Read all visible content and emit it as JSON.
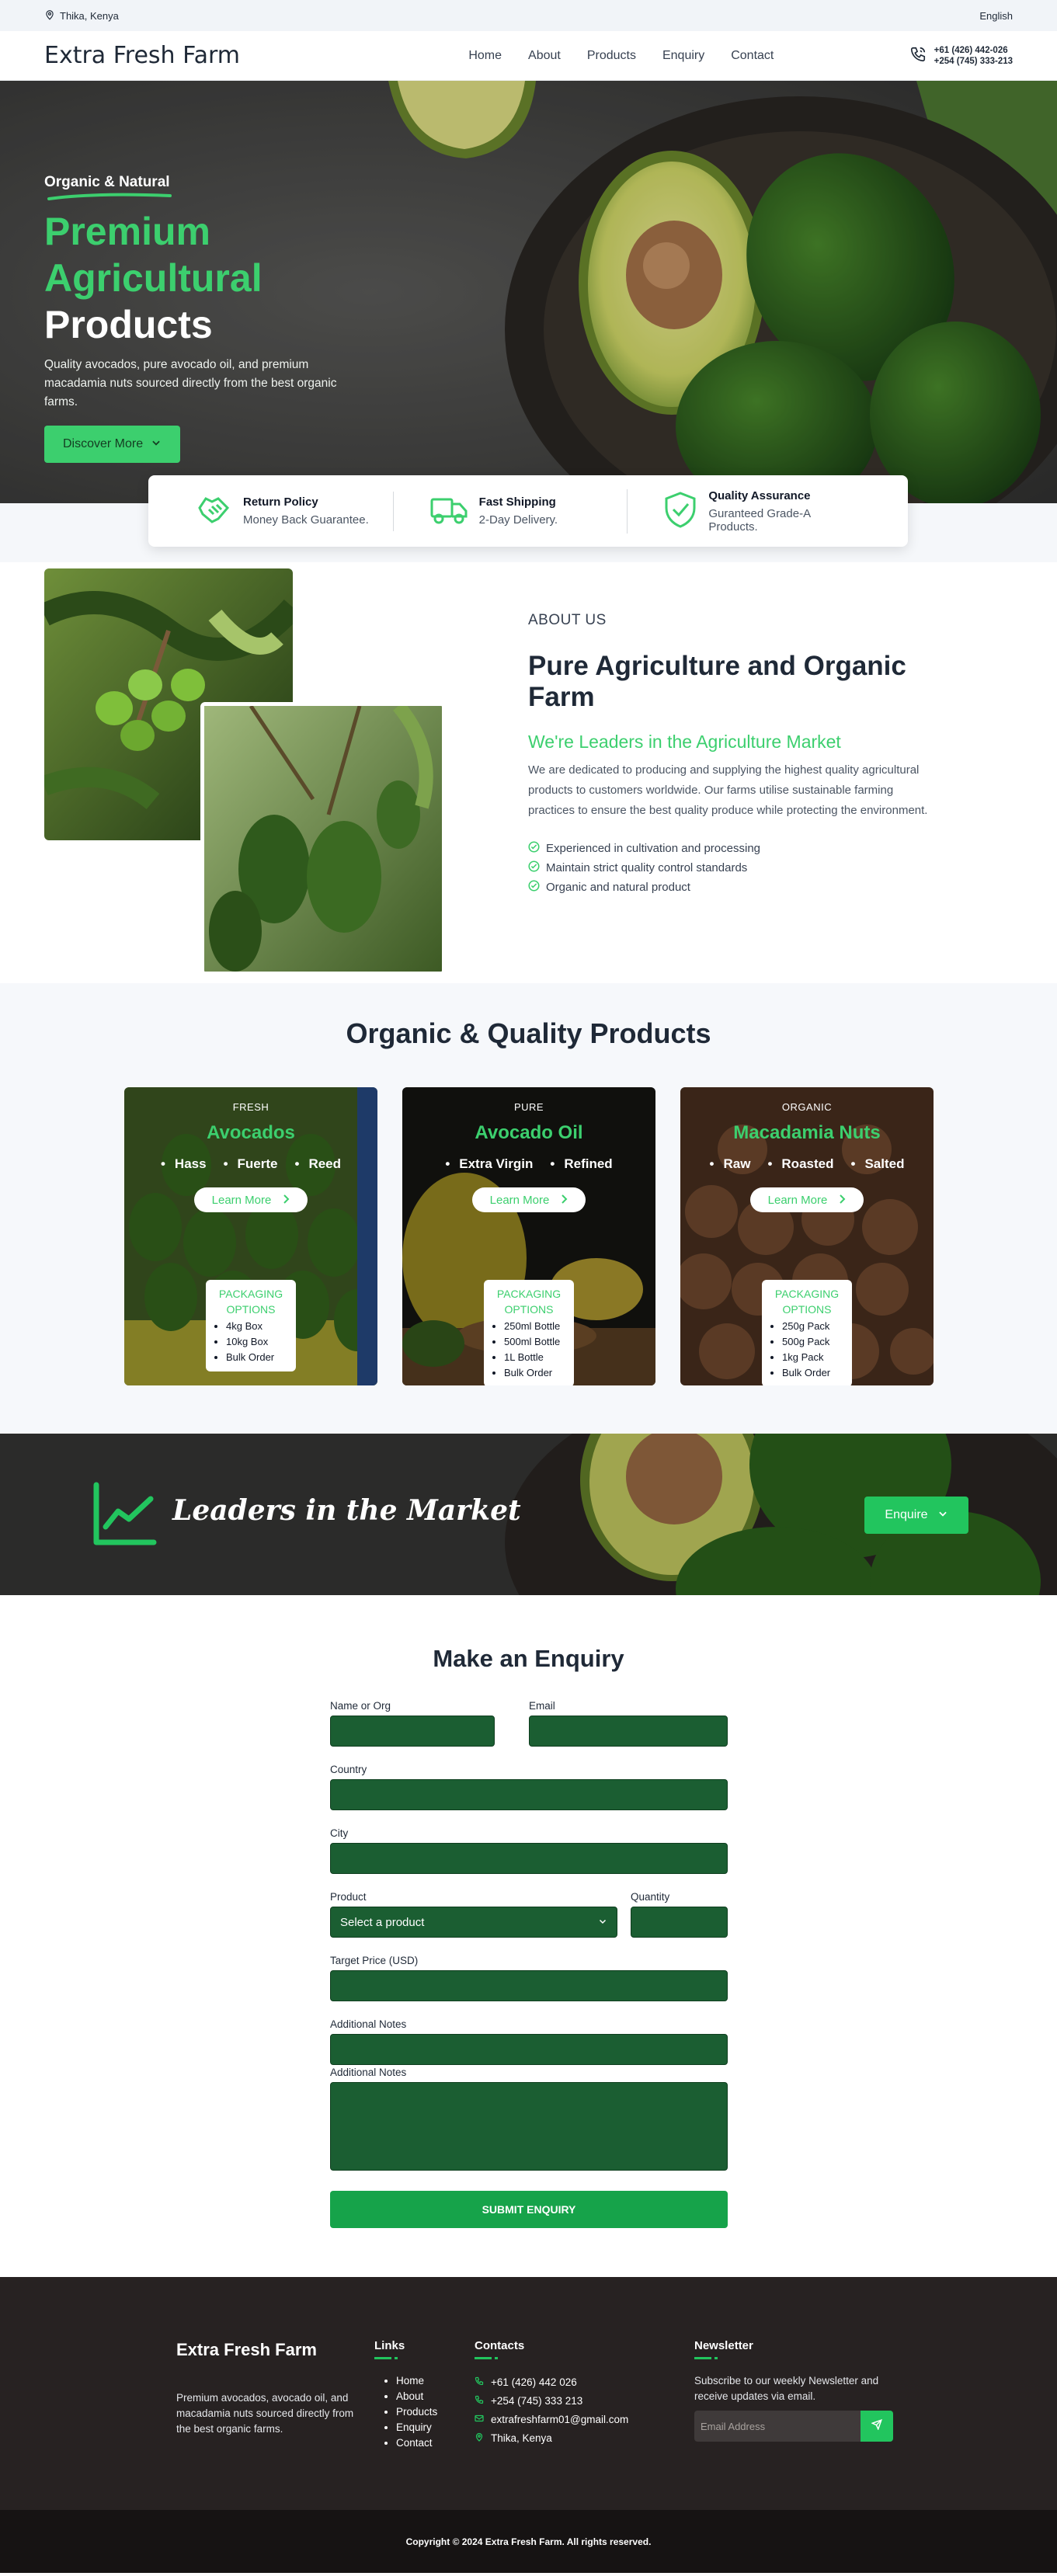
{
  "topbar": {
    "location": "Thika, Kenya",
    "language": "English"
  },
  "nav": {
    "brand": "Extra Fresh Farm",
    "menu": [
      "Home",
      "About",
      "Products",
      "Enquiry",
      "Contact"
    ],
    "phones": [
      "+61 (426) 442-026",
      "+254 (745) 333-213"
    ]
  },
  "hero": {
    "tag": "Organic & Natural",
    "title_green": "Premium Agricultural",
    "title_white": "Products",
    "description": "Quality avocados, pure avocado oil, and premium macadamia nuts sourced directly from the best organic farms.",
    "button": "Discover More"
  },
  "features": [
    {
      "title": "Return Policy",
      "subtitle": "Money Back Guarantee.",
      "icon": "handshake-icon"
    },
    {
      "title": "Fast Shipping",
      "subtitle": "2-Day Delivery.",
      "icon": "truck-icon"
    },
    {
      "title": "Quality Assurance",
      "subtitle": "Guranteed Grade-A Products.",
      "icon": "shield-check-icon"
    }
  ],
  "about": {
    "overline": "ABOUT US",
    "title": "Pure Agriculture and Organic Farm",
    "subtitle": "We're Leaders in the Agriculture Market",
    "description": "We are dedicated to producing and supplying the highest quality agricultural products to customers worldwide. Our farms utilise sustainable farming practices to ensure the best quality produce while protecting the environment.",
    "points": [
      "Experienced in cultivation and processing",
      "Maintain strict quality control standards",
      "Organic and natural product"
    ]
  },
  "products": {
    "title": "Organic & Quality Products",
    "packaging_title": "PACKAGING OPTIONS",
    "learn_more": "Learn More",
    "items": [
      {
        "kind": "FRESH",
        "name": "Avocados",
        "types": [
          "Hass",
          "Fuerte",
          "Reed"
        ],
        "packaging": [
          "4kg Box",
          "10kg Box",
          "Bulk Order"
        ]
      },
      {
        "kind": "PURE",
        "name": "Avocado Oil",
        "types": [
          "Extra Virgin",
          "Refined"
        ],
        "packaging": [
          "250ml Bottle",
          "500ml Bottle",
          "1L Bottle",
          "Bulk Order"
        ]
      },
      {
        "kind": "ORGANIC",
        "name": "Macadamia Nuts",
        "types": [
          "Raw",
          "Roasted",
          "Salted"
        ],
        "packaging": [
          "250g Pack",
          "500g Pack",
          "1kg Pack",
          "Bulk Order"
        ]
      }
    ]
  },
  "leaders": {
    "title": "Leaders in the Market",
    "button": "Enquire"
  },
  "enquiry": {
    "title": "Make an Enquiry",
    "labels": {
      "name": "Name or Org",
      "email": "Email",
      "country": "Country",
      "city": "City",
      "product": "Product",
      "quantity": "Quantity",
      "target_price": "Target Price (USD)",
      "notes1": "Additional Notes",
      "notes2": "Additional Notes"
    },
    "product_select": "Select a product",
    "submit": "SUBMIT ENQUIRY"
  },
  "footer": {
    "brand": "Extra Fresh Farm",
    "description": "Premium avocados, avocado oil, and macadamia nuts sourced directly from the best organic farms.",
    "links_title": "Links",
    "links": [
      "Home",
      "About",
      "Products",
      "Enquiry",
      "Contact"
    ],
    "contacts_title": "Contacts",
    "contacts": [
      "+61 (426) 442 026",
      "+254 (745) 333 213",
      "extrafreshfarm01@gmail.com",
      "Thika, Kenya"
    ],
    "newsletter_title": "Newsletter",
    "newsletter_text": "Subscribe to our weekly Newsletter and receive updates via email.",
    "email_placeholder": "Email Address"
  },
  "copyright": "Copyright © 2024 Extra Fresh Farm. All rights reserved.",
  "colors": {
    "accent": "#3ccf6e",
    "form_field": "#1b5e32",
    "footer_bg": "#272222"
  }
}
